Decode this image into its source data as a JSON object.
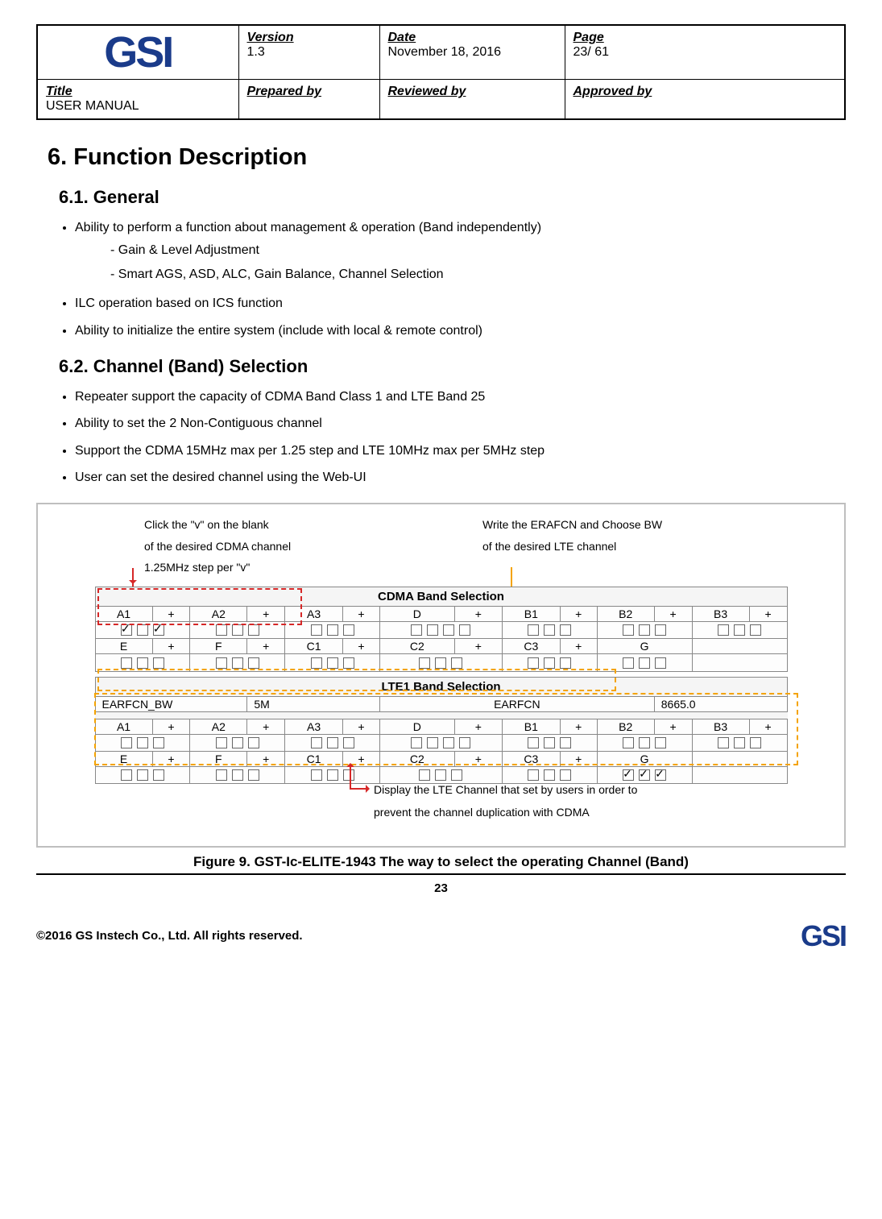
{
  "header": {
    "logo": "GSI",
    "version_label": "Version",
    "version_value": "1.3",
    "date_label": "Date",
    "date_value": "November 18, 2016",
    "page_label": "Page",
    "page_value": "23/ 61",
    "title_label": "Title",
    "title_value": "USER MANUAL",
    "prepared_label": "Prepared by",
    "reviewed_label": "Reviewed by",
    "approved_label": "Approved by"
  },
  "section_heading": "6.   Function Description",
  "sub1_heading": "6.1.  General",
  "bullets1": {
    "b1": "Ability to perform a function about management & operation (Band independently)",
    "b1s1": "-  Gain  &  Level  Adjustment",
    "b1s2": "-  Smart  AGS,  ASD,  ALC,  Gain  Balance,  Channel  Selection",
    "b2": "ILC operation based on ICS function",
    "b3": "Ability to initialize the entire system (include with local & remote control)"
  },
  "sub2_heading": "6.2.  Channel (Band) Selection",
  "bullets2": {
    "b1": "Repeater support the capacity of CDMA Band Class 1 and LTE Band 25",
    "b2": "Ability to set the 2 Non-Contiguous channel",
    "b3": "Support the CDMA 15MHz max per 1.25 step and LTE 10MHz max per 5MHz step",
    "b4": "User can set the desired channel using the Web-UI"
  },
  "annotations": {
    "topleft_l1": "Click the \"v\" on the blank",
    "topleft_l2": "of the desired CDMA channel",
    "topleft_l3": "1.25MHz step per \"v\"",
    "topright_l1": "Write the ERAFCN and Choose BW",
    "topright_l2": "of the desired LTE channel",
    "bottom_l1": "Display the LTE Channel that set by users in order to",
    "bottom_l2": "prevent the channel duplication with CDMA"
  },
  "cdma_table": {
    "title": "CDMA Band Selection",
    "row1": [
      "A1",
      "+",
      "A2",
      "+",
      "A3",
      "+",
      "D",
      "+",
      "B1",
      "+",
      "B2",
      "+",
      "B3",
      "+"
    ],
    "row3": [
      "E",
      "+",
      "F",
      "+",
      "C1",
      "+",
      "C2",
      "+",
      "C3",
      "+",
      "G",
      "",
      ""
    ]
  },
  "lte_table": {
    "title": "LTE1 Band Selection",
    "earfcn_bw_label": "EARFCN_BW",
    "earfcn_bw_value": "5M",
    "earfcn_label": "EARFCN",
    "earfcn_value": "8665.0",
    "row1": [
      "A1",
      "+",
      "A2",
      "+",
      "A3",
      "+",
      "D",
      "+",
      "B1",
      "+",
      "B2",
      "+",
      "B3",
      "+"
    ],
    "row3": [
      "E",
      "+",
      "F",
      "+",
      "C1",
      "+",
      "C2",
      "+",
      "C3",
      "+",
      "G",
      "",
      ""
    ]
  },
  "caption": "Figure 9. GST-Ic-ELITE-1943 The way to select the operating Channel (Band)",
  "page_number": "23",
  "footer_text": "©2016 GS Instech Co., Ltd.    All rights reserved.",
  "footer_logo": "GSI"
}
